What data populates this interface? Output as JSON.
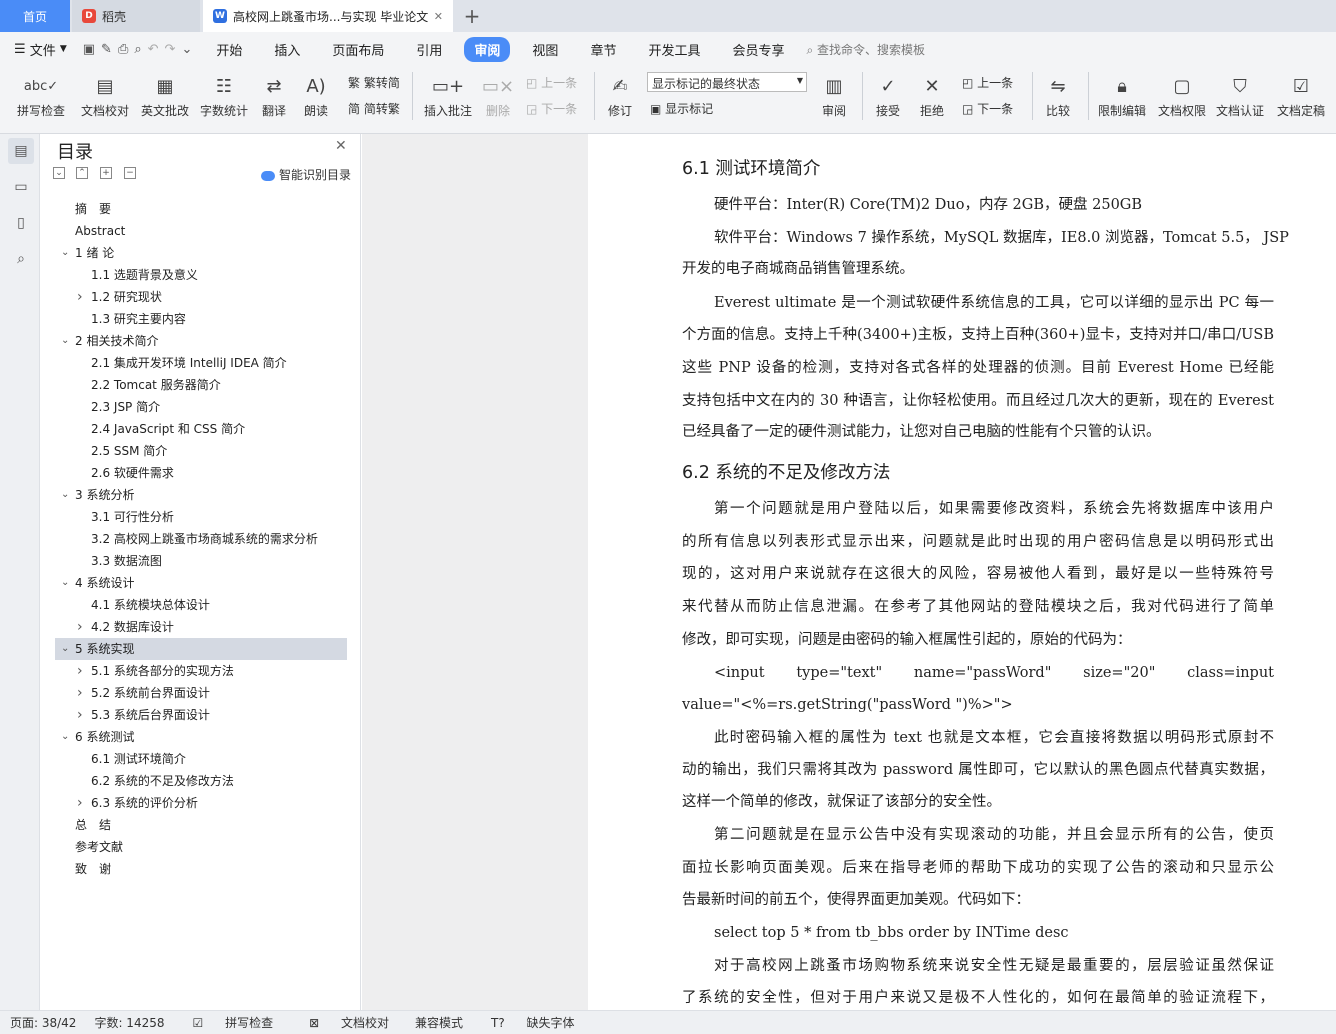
{
  "tabs": [
    {
      "label": "首页"
    },
    {
      "label": "稻壳"
    },
    {
      "label": "高校网上跳蚤市场...与实现 毕业论文"
    }
  ],
  "menubar": {
    "file": "文件",
    "items": [
      "开始",
      "插入",
      "页面布局",
      "引用",
      "审阅",
      "视图",
      "章节",
      "开发工具",
      "会员专享"
    ],
    "active": "审阅",
    "search": "查找命令、搜索模板"
  },
  "ribbon": {
    "spellcheck": "拼写检查",
    "doc_proof": "文档校对",
    "en_review": "英文批改",
    "word_count": "字数统计",
    "translate": "翻译",
    "read_aloud": "朗读",
    "trad_to_simp": "繁转简",
    "simp_to_trad": "简转繁",
    "insert_comment": "插入批注",
    "delete": "删除",
    "prev_comment": "上一条",
    "next_comment": "下一条",
    "revise": "修订",
    "markup_select": "显示标记的最终状态",
    "show_markup": "显示标记",
    "review": "审阅",
    "accept": "接受",
    "reject": "拒绝",
    "prev_change": "上一条",
    "next_change": "下一条",
    "compare": "比较",
    "restrict_edit": "限制编辑",
    "doc_permission": "文档权限",
    "doc_auth": "文档认证",
    "doc_finalize": "文档定稿"
  },
  "toc": {
    "title": "目录",
    "smart": "智能识别目录",
    "items": [
      {
        "text": "摘　要",
        "level": 0,
        "arrow": ""
      },
      {
        "text": "Abstract",
        "level": 0,
        "arrow": ""
      },
      {
        "text": "1  绪  论",
        "level": 0,
        "arrow": "v"
      },
      {
        "text": "1.1 选题背景及意义",
        "level": 1,
        "arrow": ""
      },
      {
        "text": "1.2 研究现状",
        "level": 1,
        "arrow": ">"
      },
      {
        "text": "1.3 研究主要内容",
        "level": 1,
        "arrow": ""
      },
      {
        "text": "2  相关技术简介",
        "level": 0,
        "arrow": "v"
      },
      {
        "text": "2.1 集成开发环境 IntelliJ IDEA 简介",
        "level": 1,
        "arrow": ""
      },
      {
        "text": "2.2 Tomcat 服务器简介",
        "level": 1,
        "arrow": ""
      },
      {
        "text": "2.3 JSP 简介",
        "level": 1,
        "arrow": ""
      },
      {
        "text": "2.4 JavaScript 和 CSS 简介",
        "level": 1,
        "arrow": ""
      },
      {
        "text": "2.5 SSM 简介",
        "level": 1,
        "arrow": ""
      },
      {
        "text": "2.6 软硬件需求",
        "level": 1,
        "arrow": ""
      },
      {
        "text": "3  系统分析",
        "level": 0,
        "arrow": "v"
      },
      {
        "text": "3.1 可行性分析",
        "level": 1,
        "arrow": ""
      },
      {
        "text": "3.2 高校网上跳蚤市场商城系统的需求分析",
        "level": 1,
        "arrow": ""
      },
      {
        "text": "3.3 数据流图",
        "level": 1,
        "arrow": ""
      },
      {
        "text": "4  系统设计",
        "level": 0,
        "arrow": "v"
      },
      {
        "text": "4.1 系统模块总体设计",
        "level": 1,
        "arrow": ""
      },
      {
        "text": "4.2 数据库设计",
        "level": 1,
        "arrow": ">"
      },
      {
        "text": "5  系统实现",
        "level": 0,
        "arrow": "v"
      },
      {
        "text": "5.1  系统各部分的实现方法",
        "level": 1,
        "arrow": ">"
      },
      {
        "text": "5.2  系统前台界面设计",
        "level": 1,
        "arrow": ">"
      },
      {
        "text": "5.3 系统后台界面设计",
        "level": 1,
        "arrow": ">"
      },
      {
        "text": "6  系统测试",
        "level": 0,
        "arrow": "v"
      },
      {
        "text": "6.1 测试环境简介",
        "level": 1,
        "arrow": ""
      },
      {
        "text": "6.2 系统的不足及修改方法",
        "level": 1,
        "arrow": ""
      },
      {
        "text": "6.3  系统的评价分析",
        "level": 1,
        "arrow": ">"
      },
      {
        "text": "总　结",
        "level": 0,
        "arrow": ""
      },
      {
        "text": "参考文献",
        "level": 0,
        "arrow": ""
      },
      {
        "text": "致　谢",
        "level": 0,
        "arrow": ""
      }
    ]
  },
  "document": {
    "lines": [
      {
        "text": "6.1 测试环境简介",
        "style": "h",
        "indent": false,
        "justify": false
      },
      {
        "text": "硬件平台：Inter(R) Core(TM)2 Duo，内存 2GB，硬盘 250GB",
        "style": "p",
        "indent": true,
        "justify": false
      },
      {
        "text": "软件平台：Windows 7 操作系统，MySQL 数据库，IE8.0 浏览器，Tomcat 5.5， JSP",
        "style": "p",
        "indent": true,
        "justify": true
      },
      {
        "text": "开发的电子商城商品销售管理系统。",
        "style": "p",
        "indent": false,
        "justify": false
      },
      {
        "text": "Everest ultimate 是一个测试软硬件系统信息的工具，它可以详细的显示出 PC 每一",
        "style": "p",
        "indent": true,
        "justify": true
      },
      {
        "text": "个方面的信息。支持上千种(3400+)主板，支持上百种(360+)显卡，支持对并口/串口/USB",
        "style": "p",
        "indent": false,
        "justify": true
      },
      {
        "text": "这些 PNP 设备的检测，支持对各式各样的处理器的侦测。目前 Everest Home 已经能",
        "style": "p",
        "indent": false,
        "justify": true
      },
      {
        "text": "支持包括中文在内的 30 种语言，让你轻松使用。而且经过几次大的更新，现在的 Everest",
        "style": "p",
        "indent": false,
        "justify": true
      },
      {
        "text": "已经具备了一定的硬件测试能力，让您对自己电脑的性能有个只管的认识。",
        "style": "p",
        "indent": false,
        "justify": false
      },
      {
        "text": "6.2 系统的不足及修改方法",
        "style": "h",
        "indent": false,
        "justify": false
      },
      {
        "text": "第一个问题就是用户登陆以后，如果需要修改资料，系统会先将数据库中该用户",
        "style": "p",
        "indent": true,
        "justify": true
      },
      {
        "text": "的所有信息以列表形式显示出来，问题就是此时出现的用户密码信息是以明码形式出",
        "style": "p",
        "indent": false,
        "justify": true
      },
      {
        "text": "现的，这对用户来说就存在这很大的风险，容易被他人看到，最好是以一些特殊符号",
        "style": "p",
        "indent": false,
        "justify": true
      },
      {
        "text": "来代替从而防止信息泄漏。在参考了其他网站的登陆模块之后，我对代码进行了简单",
        "style": "p",
        "indent": false,
        "justify": true
      },
      {
        "text": "修改，即可实现，问题是由密码的输入框属性引起的，原始的代码为：",
        "style": "p",
        "indent": false,
        "justify": false
      },
      {
        "text": "<input     type=\"text\"     name=\"passWord\"     size=\"20\"     class=input",
        "style": "p",
        "indent": true,
        "justify": true
      },
      {
        "text": "value=\"<%=rs.getString(\"passWord \")%>\">",
        "style": "p",
        "indent": false,
        "justify": false
      },
      {
        "text": "此时密码输入框的属性为 text 也就是文本框，它会直接将数据以明码形式原封不",
        "style": "p",
        "indent": true,
        "justify": true
      },
      {
        "text": "动的输出，我们只需将其改为 password 属性即可，它以默认的黑色圆点代替真实数据，",
        "style": "p",
        "indent": false,
        "justify": true
      },
      {
        "text": "这样一个简单的修改，就保证了该部分的安全性。",
        "style": "p",
        "indent": false,
        "justify": false
      },
      {
        "text": "第二问题就是在显示公告中没有实现滚动的功能，并且会显示所有的公告，使页",
        "style": "p",
        "indent": true,
        "justify": true
      },
      {
        "text": "面拉长影响页面美观。后来在指导老师的帮助下成功的实现了公告的滚动和只显示公",
        "style": "p",
        "indent": false,
        "justify": true
      },
      {
        "text": "告最新时间的前五个，使得界面更加美观。代码如下：",
        "style": "p",
        "indent": false,
        "justify": false
      },
      {
        "text": "select top 5 * from tb_bbs order by INTime desc",
        "style": "p",
        "indent": true,
        "justify": false
      },
      {
        "text": "对于高校网上跳蚤市场购物系统来说安全性无疑是最重要的，层层验证虽然保证",
        "style": "p",
        "indent": true,
        "justify": true
      },
      {
        "text": "了系统的安全性，但对于用户来说又是极不人性化的，如何在最简单的验证流程下，",
        "style": "p",
        "indent": false,
        "justify": true
      }
    ]
  },
  "status": {
    "page": "页面: 38/42",
    "words": "字数: 14258",
    "spell": "拼写检查",
    "proof": "文档校对",
    "compat": "兼容模式",
    "missing_font": "缺失字体"
  }
}
